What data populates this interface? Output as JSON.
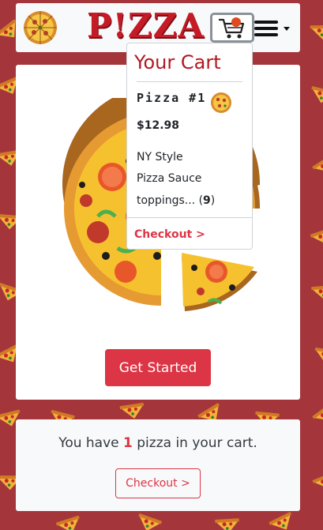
{
  "navbar": {
    "brand": "P!ZZA",
    "logo_icon": "pizza-logo-icon",
    "cart_icon": "shopping-cart-icon",
    "menu_icon": "hamburger-menu-icon"
  },
  "hero": {
    "image_icon": "pizza-illustration",
    "get_started_label": "Get Started"
  },
  "cart_dropdown": {
    "title": "Your Cart",
    "item_name": "Pizza #1",
    "item_thumb_icon": "pizza-thumbnail-icon",
    "price": "$12.98",
    "style": "NY Style",
    "sauce": "Pizza Sauce",
    "toppings_label": "toppings... (",
    "toppings_count": "9",
    "toppings_close": ")",
    "checkout_label": "Checkout >"
  },
  "summary": {
    "prefix": "You have ",
    "count": "1",
    "suffix": " pizza in your cart.",
    "checkout_label": "Checkout >"
  },
  "colors": {
    "background": "#a4363b",
    "accent": "#dc3545",
    "brand": "#c41b26"
  }
}
